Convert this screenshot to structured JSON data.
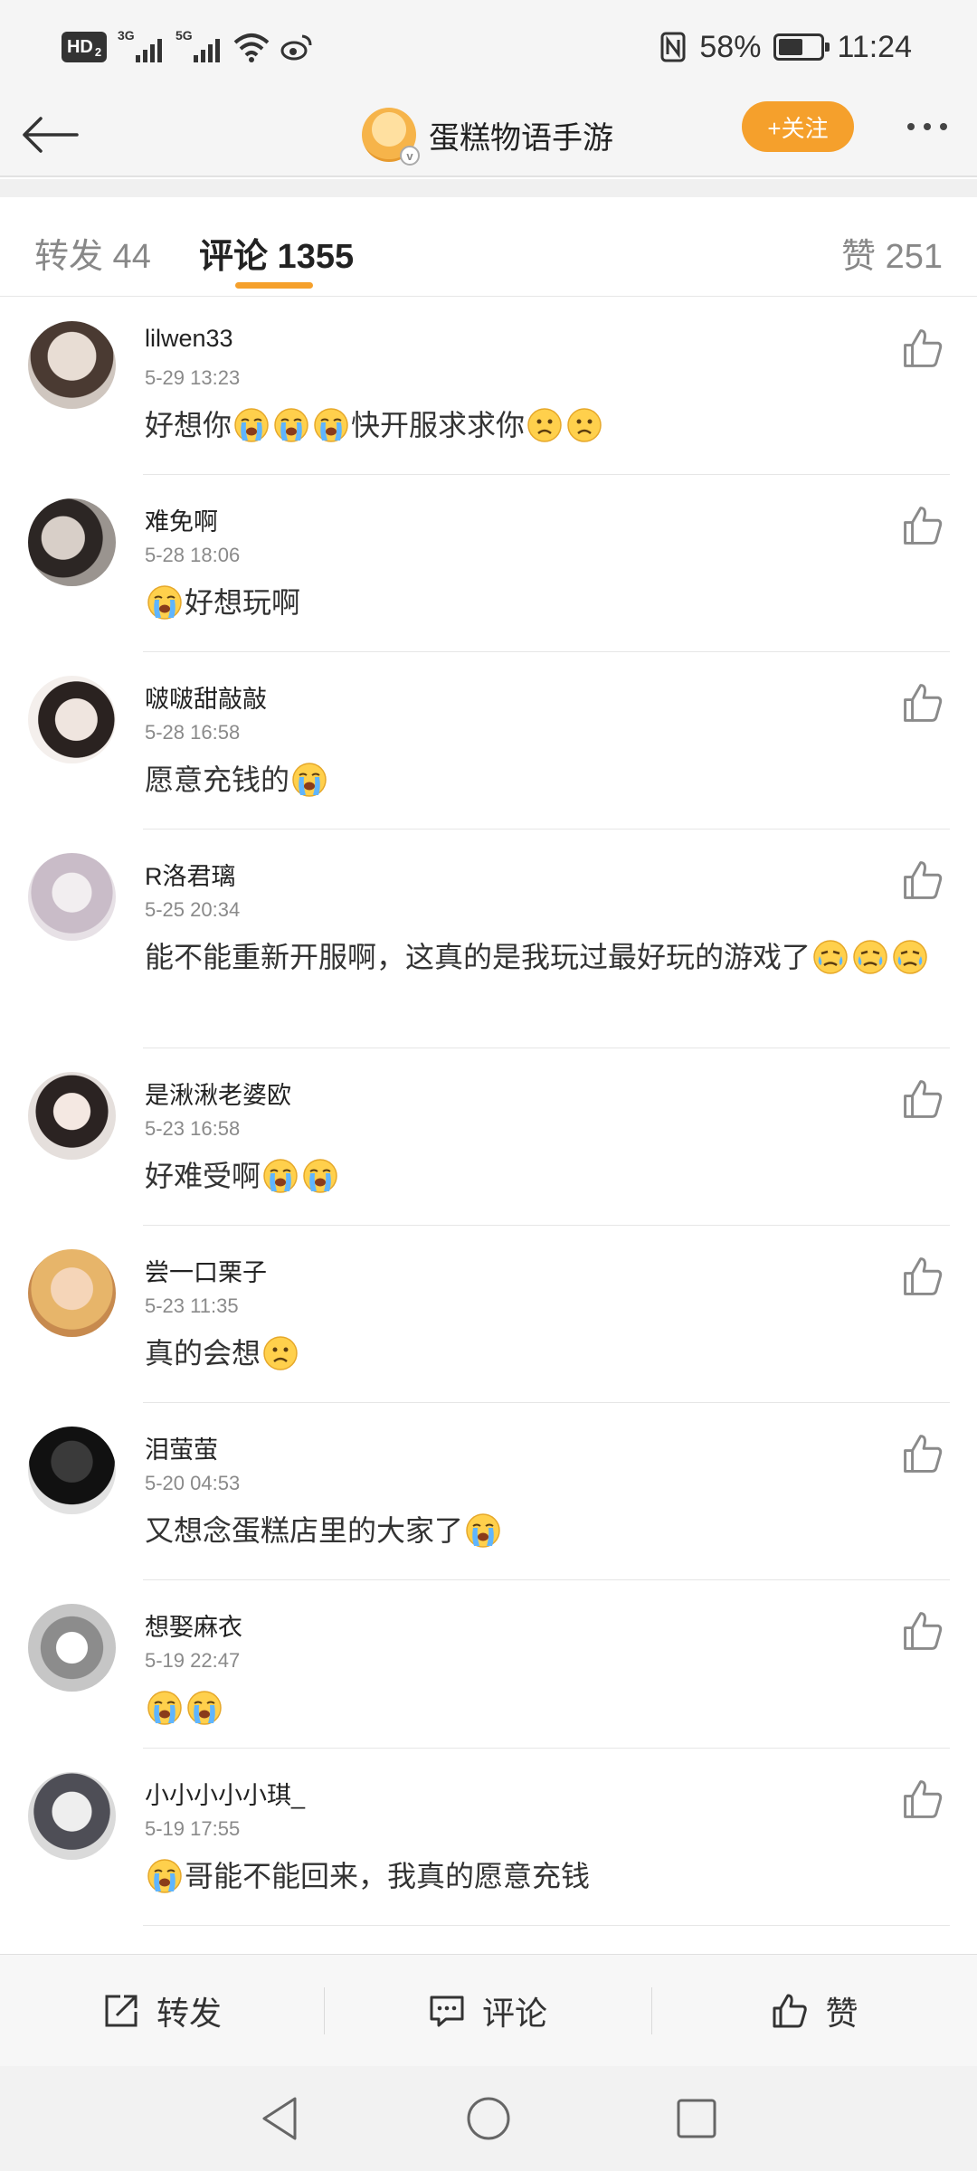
{
  "status_bar": {
    "hd": "HD",
    "hd_sub": "2",
    "sig1_gen": "3G",
    "sig2_gen": "5G",
    "battery_percent": "58%",
    "battery_level": 0.58,
    "time": "11:24"
  },
  "header": {
    "title": "蛋糕物语手游",
    "follow_label": "+关注",
    "accent": "#f5a02c"
  },
  "tabs": {
    "repost": "转发 44",
    "comments": "评论 1355",
    "likes": "赞 251"
  },
  "comments": [
    {
      "username": "lilwen33",
      "time": "5-29 13:23",
      "text": [
        "好想你",
        "cry",
        "cry",
        "cry",
        "快开服求求你",
        "sad",
        "sad"
      ]
    },
    {
      "username": "难免啊",
      "time": "5-28 18:06",
      "text": [
        "cry",
        "好想玩啊"
      ]
    },
    {
      "username": "啵啵甜敲敲",
      "time": "5-28 16:58",
      "text": [
        "愿意充钱的",
        "cry"
      ]
    },
    {
      "username": "R洛君璃",
      "time": "5-25 20:34",
      "text": [
        "能不能重新开服啊，这真的是我玩过最好玩的游戏了",
        "tear",
        "tear",
        "tear"
      ]
    },
    {
      "username": "是湫湫老婆欧",
      "time": "5-23 16:58",
      "text": [
        "好难受啊",
        "cry",
        "cry"
      ]
    },
    {
      "username": "尝一口栗子",
      "time": "5-23 11:35",
      "text": [
        "真的会想",
        "sad"
      ]
    },
    {
      "username": "泪萤萤",
      "time": "5-20 04:53",
      "text": [
        "又想念蛋糕店里的大家了",
        "cry"
      ]
    },
    {
      "username": "想娶麻衣",
      "time": "5-19 22:47",
      "text": [
        "cry",
        "cry"
      ]
    },
    {
      "username": "小小小小小琪_",
      "time": "5-19 17:55",
      "text": [
        "cry",
        "哥能不能回来，我真的愿意充钱"
      ]
    }
  ],
  "action_bar": {
    "repost": "转发",
    "comment": "评论",
    "like": "赞"
  }
}
